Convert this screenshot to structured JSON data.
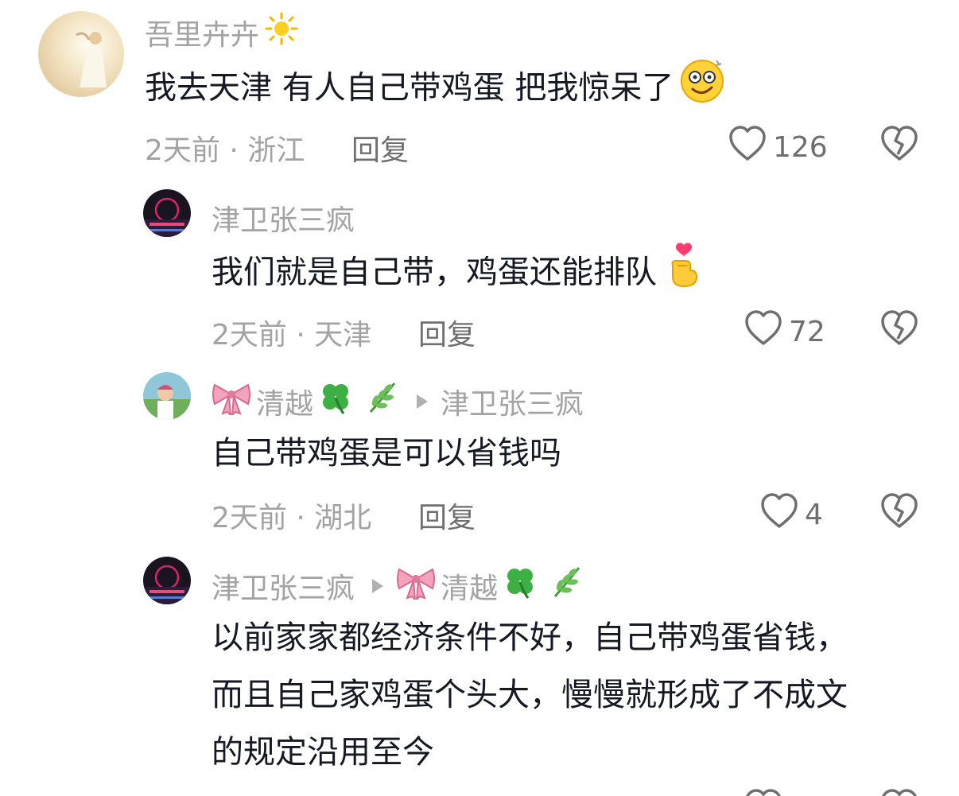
{
  "comments": [
    {
      "username": "吾里卉卉",
      "username_emoji_icon": "sun-icon",
      "text": "我去天津 有人自己带鸡蛋 把我惊呆了",
      "text_emoji_icon": "dizzy-face-icon",
      "meta": "2天前 · 浙江",
      "reply_label": "回复",
      "likes": "126"
    },
    {
      "username": "津卫张三疯",
      "text": "我们就是自己带，鸡蛋还能排队",
      "text_emoji_icon": "finger-heart-icon",
      "meta": "2天前 · 天津",
      "reply_label": "回复",
      "likes": "72"
    },
    {
      "username": "清越",
      "username_prefix_icon": "pink-bow-icon",
      "username_suffix_icons": [
        "four-leaf-clover-icon",
        "herb-icon"
      ],
      "reply_to": "津卫张三疯",
      "text": "自己带鸡蛋是可以省钱吗",
      "meta": "2天前 · 湖北",
      "reply_label": "回复",
      "likes": "4"
    },
    {
      "username": "津卫张三疯",
      "reply_to": "清越",
      "reply_to_prefix_icon": "pink-bow-icon",
      "reply_to_suffix_icons": [
        "four-leaf-clover-icon",
        "herb-icon"
      ],
      "text_lines": [
        "以前家家都经济条件不好，自己带鸡蛋省钱，",
        "而且自己家鸡蛋个头大，慢慢就形成了不成文",
        "的规定沿用至今"
      ]
    }
  ],
  "colors": {
    "text_primary": "#161823",
    "text_secondary": "#a3a3a3",
    "icon_gray": "#6f6f6f"
  }
}
